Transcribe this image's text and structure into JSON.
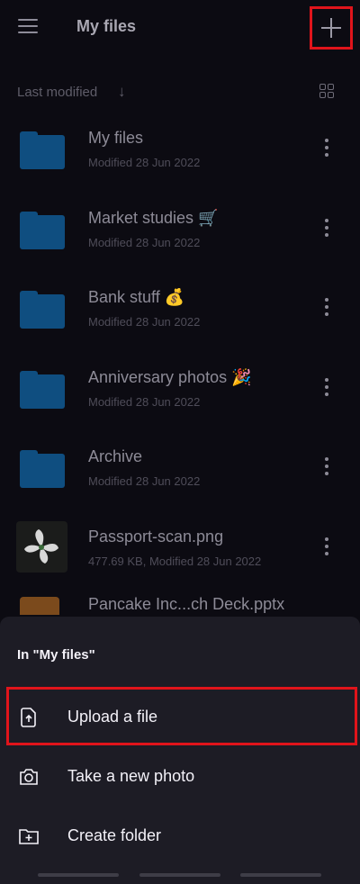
{
  "appbar": {
    "title": "My files",
    "menu_icon": "hamburger-menu-icon",
    "add_icon": "plus-icon"
  },
  "sortbar": {
    "label": "Last modified",
    "arrow": "↓",
    "view_icon": "grid-view-icon"
  },
  "files": [
    {
      "title": "My files",
      "subtitle": "Modified 28 Jun 2022",
      "kind": "folder"
    },
    {
      "title": "Market studies 🛒",
      "subtitle": "Modified 28 Jun 2022",
      "kind": "folder"
    },
    {
      "title": "Bank stuff 💰",
      "subtitle": "Modified 28 Jun 2022",
      "kind": "folder"
    },
    {
      "title": "Anniversary photos 🎉",
      "subtitle": "Modified 28 Jun 2022",
      "kind": "folder"
    },
    {
      "title": "Archive",
      "subtitle": "Modified 28 Jun 2022",
      "kind": "folder"
    },
    {
      "title": "Passport-scan.png",
      "subtitle": "477.69 KB, Modified 28 Jun 2022",
      "kind": "image"
    },
    {
      "title": "Pancake Inc...ch Deck.pptx",
      "subtitle": "",
      "kind": "presentation"
    }
  ],
  "sheet": {
    "title": "In \"My files\"",
    "items": [
      {
        "label": "Upload a file",
        "icon": "upload-file-icon"
      },
      {
        "label": "Take a new photo",
        "icon": "camera-icon"
      },
      {
        "label": "Create folder",
        "icon": "create-folder-icon"
      }
    ]
  },
  "colors": {
    "background": "#0c0b12",
    "sheet": "#1d1c25",
    "folder": "#0f4e80",
    "highlight": "#e0141b"
  }
}
